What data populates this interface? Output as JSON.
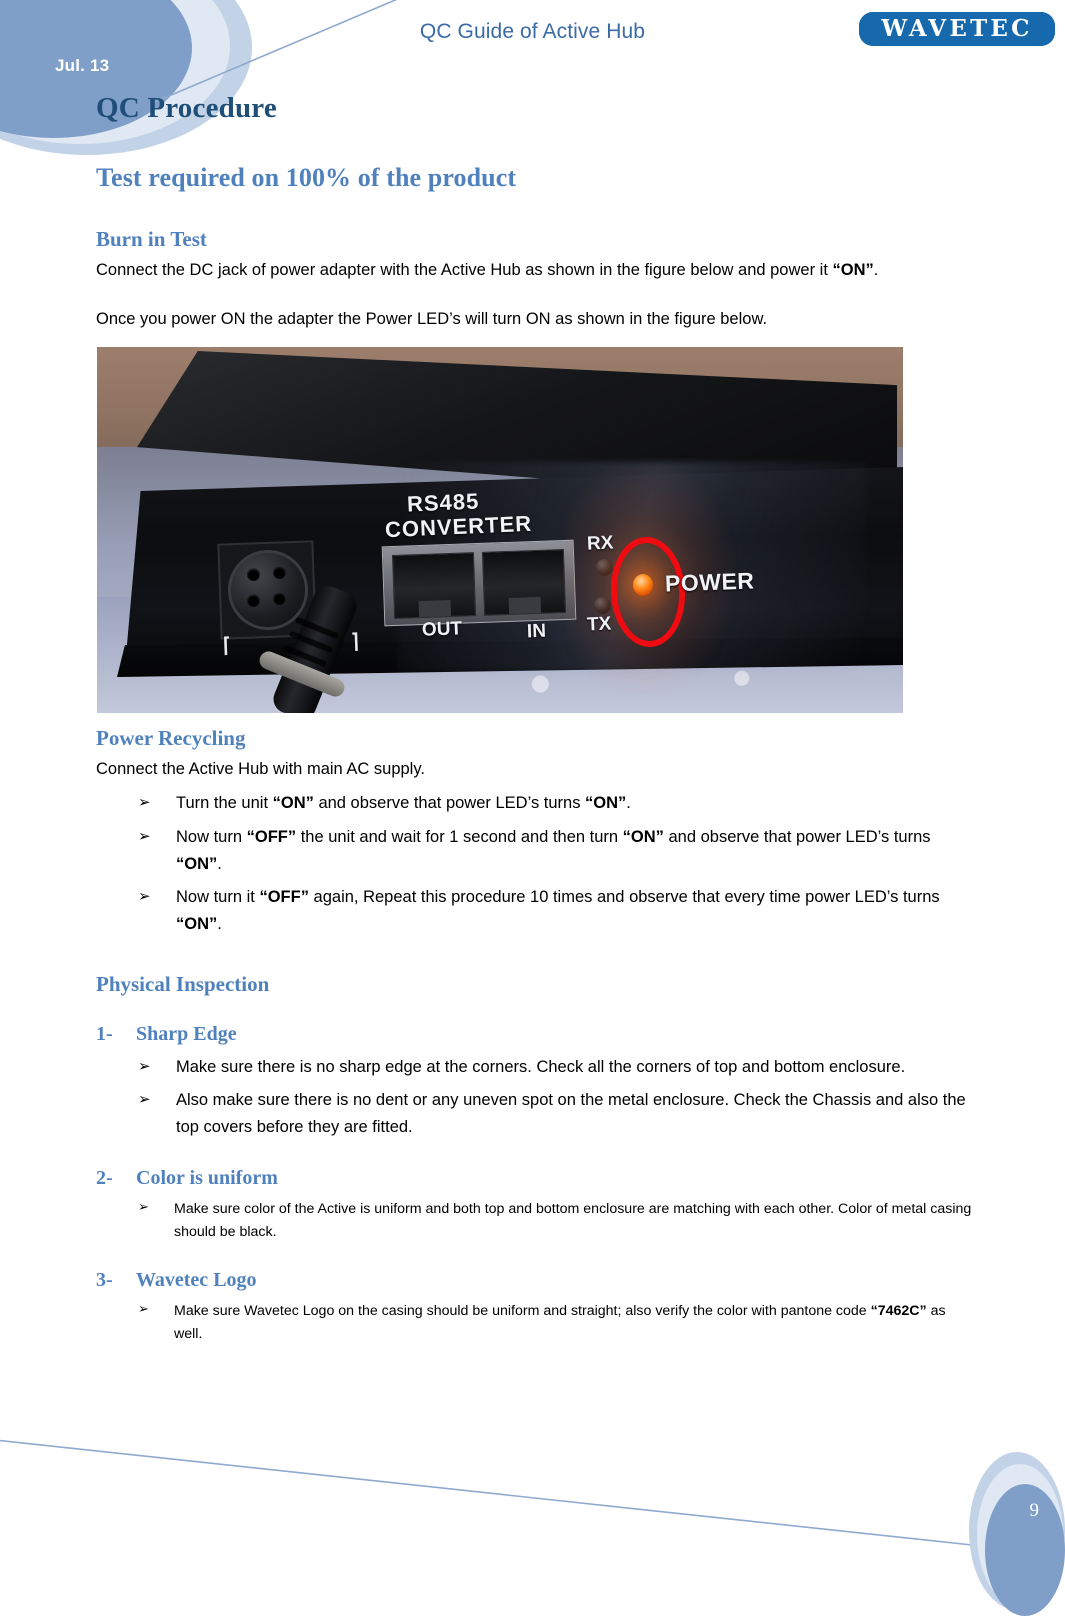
{
  "header": {
    "date_badge": "Jul. 13",
    "title": "QC Guide of Active Hub",
    "logo_text": "WAVETEC"
  },
  "colors": {
    "heading_dark": "#1F4E79",
    "heading_blue": "#4F81BD",
    "brand_blue": "#1669AC",
    "deco_circle_main": "#7F9FC9",
    "deco_circle_light": "#C3D3E7",
    "led_orange": "#FF8B1A",
    "annotation_red": "#EE0B12"
  },
  "content": {
    "h1": "QC Procedure",
    "h2": "Test required on 100% of the product",
    "burn_in": {
      "heading": "Burn in Test",
      "p1_a": "Connect the DC jack of power adapter with the Active Hub as shown in the figure below and power it ",
      "p1_b": "“ON”",
      "p1_c": ".",
      "p2": "Once you power ON the adapter the Power LED’s will turn ON as shown in the figure below."
    },
    "figure": {
      "name": "active-hub-rear-panel-photo",
      "labels": {
        "rs485": "RS485",
        "converter": "CONVERTER",
        "rx": "RX",
        "tx": "TX",
        "power": "POWER",
        "out": "OUT",
        "in": "IN"
      },
      "annotation": "red-ellipse-highlighting-power-led"
    },
    "power_recycling": {
      "heading": "Power Recycling",
      "intro": "Connect the Active Hub with main AC supply.",
      "bullets": [
        {
          "parts": [
            {
              "t": "Turn the unit ",
              "b": false
            },
            {
              "t": "“ON”",
              "b": true
            },
            {
              "t": " and observe that power LED’s turns ",
              "b": false
            },
            {
              "t": "“ON”",
              "b": true
            },
            {
              "t": ".",
              "b": false
            }
          ]
        },
        {
          "parts": [
            {
              "t": "Now turn ",
              "b": false
            },
            {
              "t": "“OFF”",
              "b": true
            },
            {
              "t": " the unit and wait for 1 second and then turn ",
              "b": false
            },
            {
              "t": "“ON”",
              "b": true
            },
            {
              "t": " and observe that power LED’s turns ",
              "b": false
            },
            {
              "t": "“ON”",
              "b": true
            },
            {
              "t": ".",
              "b": false
            }
          ]
        },
        {
          "parts": [
            {
              "t": "Now turn it ",
              "b": false
            },
            {
              "t": "“OFF”",
              "b": true
            },
            {
              "t": " again, Repeat this procedure 10 times and observe that every time power LED’s turns ",
              "b": false
            },
            {
              "t": "“ON”",
              "b": true
            },
            {
              "t": ".",
              "b": false
            }
          ]
        }
      ]
    },
    "physical_inspection": {
      "heading": "Physical Inspection",
      "items": [
        {
          "number": "1-",
          "title": "Sharp Edge",
          "small": false,
          "bullets": [
            {
              "parts": [
                {
                  "t": "Make sure there is no sharp edge at the corners. Check all the corners of top and bottom enclosure.",
                  "b": false
                }
              ]
            },
            {
              "parts": [
                {
                  "t": "Also make sure there is no dent or any uneven spot on the metal enclosure. Check the Chassis and also the top covers before they are fitted.",
                  "b": false
                }
              ]
            }
          ]
        },
        {
          "number": "2-",
          "title": "Color is uniform",
          "small": true,
          "bullets": [
            {
              "parts": [
                {
                  "t": "Make sure color of the Active is uniform and both top and bottom enclosure are matching with each other. Color of metal casing should be black.",
                  "b": false
                }
              ]
            }
          ]
        },
        {
          "number": "3-",
          "title": "Wavetec Logo",
          "small": true,
          "bullets": [
            {
              "parts": [
                {
                  "t": "Make sure Wavetec Logo on the casing should be uniform and straight; also verify the color with pantone code ",
                  "b": false
                },
                {
                  "t": "“7462C”",
                  "b": true
                },
                {
                  "t": " as well.",
                  "b": false
                }
              ]
            }
          ]
        }
      ]
    }
  },
  "footer": {
    "page_number": "9"
  },
  "bullet_glyph": "➢"
}
